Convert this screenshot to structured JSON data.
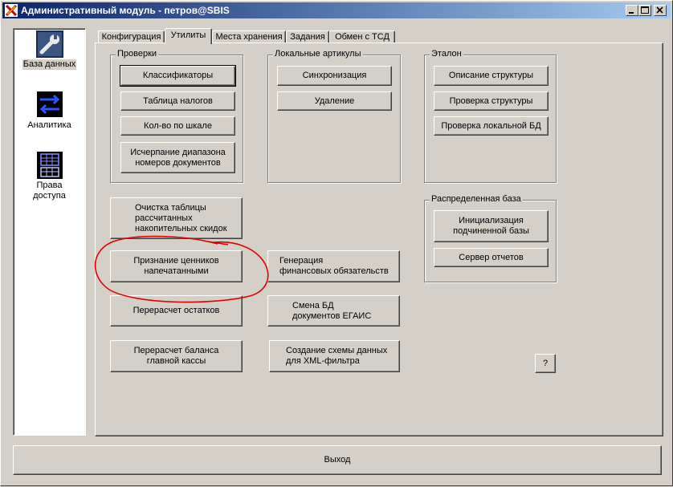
{
  "window": {
    "title": "Административный модуль - петров@SBIS",
    "controls": {
      "minimize": "_",
      "maximize": "□",
      "close": "×"
    }
  },
  "sidebar": {
    "items": [
      {
        "label": "База данных",
        "icon": "wrench-icon",
        "selected": true
      },
      {
        "label": "Аналитика",
        "icon": "arrows-icon",
        "selected": false
      },
      {
        "label": "Права\nдоступа",
        "icon": "access-grid-icon",
        "selected": false
      }
    ]
  },
  "tabs": [
    {
      "label": "Конфигурация",
      "active": false
    },
    {
      "label": "Утилиты",
      "active": true
    },
    {
      "label": "Места хранения",
      "active": false
    },
    {
      "label": "Задания",
      "active": false
    },
    {
      "label": "Обмен с ТСД",
      "active": false
    }
  ],
  "groups": {
    "checks": {
      "title": "Проверки",
      "buttons": [
        "Классификаторы",
        "Таблица налогов",
        "Кол-во по шкале",
        "Исчерпание диапазона\nномеров документов"
      ]
    },
    "local_articles": {
      "title": "Локальные артикулы",
      "buttons": [
        "Синхронизация",
        "Удаление"
      ]
    },
    "standard": {
      "title": "Эталон",
      "buttons": [
        "Описание структуры",
        "Проверка структуры",
        "Проверка локальной БД"
      ]
    },
    "distributed": {
      "title": "Распределенная база",
      "buttons": [
        "Инициализация\nподчиненной базы",
        "Сервер отчетов"
      ]
    }
  },
  "utility_buttons": {
    "clear_discounts": "Очистка таблицы\nрассчитанных\nнакопительных скидок",
    "mark_price_tags": "Признание ценников\nнапечатанными",
    "recalc_stock": "Перерасчет остатков",
    "recalc_cash": "Перерасчет баланса\nглавной кассы",
    "gen_obligations": "Генерация\nфинансовых обязательств",
    "change_egais_db": "Смена БД\nдокументов ЕГАИС",
    "xml_schema": "Создание схемы данных\nдля XML-фильтра",
    "help": "?"
  },
  "footer": {
    "exit": "Выход"
  },
  "colors": {
    "title_start": "#0a246a",
    "title_end": "#a6caf0",
    "face": "#d4d0c8",
    "annotation": "#e00000"
  }
}
